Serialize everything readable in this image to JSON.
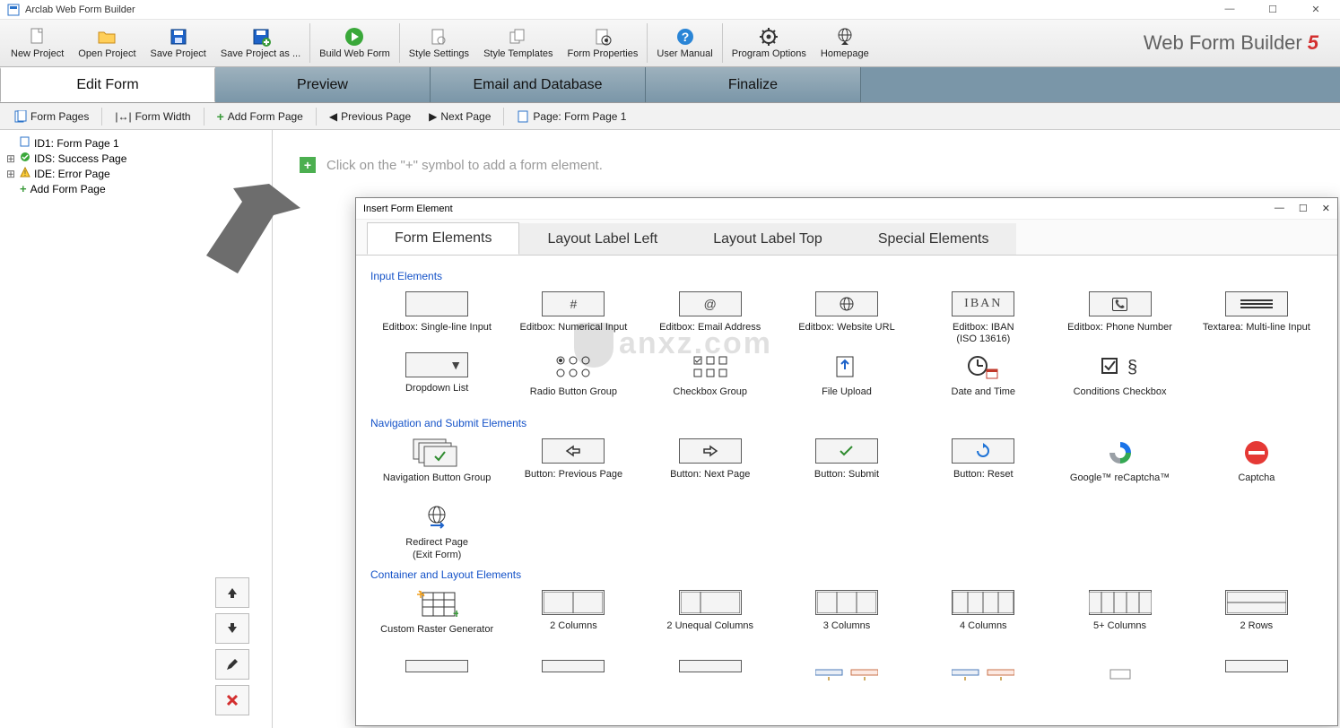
{
  "window": {
    "title": "Arclab Web Form Builder",
    "min": "—",
    "max": "☐",
    "close": "✕"
  },
  "ribbon": {
    "items": [
      {
        "label": "New Project",
        "icon": "file-new"
      },
      {
        "label": "Open Project",
        "icon": "folder-open"
      },
      {
        "label": "Save Project",
        "icon": "save"
      },
      {
        "label": "Save Project as ...",
        "icon": "save-plus"
      },
      {
        "label": "Build Web Form",
        "icon": "play"
      },
      {
        "label": "Style Settings",
        "icon": "style"
      },
      {
        "label": "Style Templates",
        "icon": "templates"
      },
      {
        "label": "Form Properties",
        "icon": "gear-doc"
      },
      {
        "label": "User Manual",
        "icon": "help"
      },
      {
        "label": "Program Options",
        "icon": "gear"
      },
      {
        "label": "Homepage",
        "icon": "globe-home"
      }
    ],
    "brand": "Web Form Builder",
    "brand_ver": "5"
  },
  "tabs": [
    "Edit Form",
    "Preview",
    "Email and Database",
    "Finalize"
  ],
  "active_tab": 0,
  "subbar": {
    "form_pages": "Form Pages",
    "form_width": "Form Width",
    "add_form_page": "Add Form Page",
    "prev_page": "Previous Page",
    "next_page": "Next Page",
    "page_label": "Page: Form Page 1"
  },
  "tree": [
    {
      "icon": "page",
      "label": "ID1: Form Page 1",
      "expandable": false
    },
    {
      "icon": "success",
      "label": "IDS: Success Page",
      "expandable": true
    },
    {
      "icon": "warning",
      "label": "IDE: Error Page",
      "expandable": true
    },
    {
      "icon": "plus",
      "label": "Add Form Page",
      "expandable": false
    }
  ],
  "canvas": {
    "hint": "Click on the \"+\" symbol to add a form element."
  },
  "dialog": {
    "title": "Insert Form Element",
    "tabs": [
      "Form Elements",
      "Layout Label Left",
      "Layout Label Top",
      "Special Elements"
    ],
    "active_tab": 0,
    "sections": [
      {
        "header": "Input Elements",
        "items": [
          {
            "label": "Editbox: Single-line Input",
            "glyph": ""
          },
          {
            "label": "Editbox: Numerical Input",
            "glyph": "#"
          },
          {
            "label": "Editbox: Email Address",
            "glyph": "@"
          },
          {
            "label": "Editbox: Website URL",
            "glyph": "globe"
          },
          {
            "label": "Editbox: IBAN (ISO 13616)",
            "glyph": "IBAN"
          },
          {
            "label": "Editbox: Phone Number",
            "glyph": "phone"
          },
          {
            "label": "Textarea: Multi-line Input",
            "glyph": "lines"
          },
          {
            "label": "Dropdown List",
            "glyph": "▼"
          },
          {
            "label": "Radio Button Group",
            "glyph": "radios",
            "noframe": true
          },
          {
            "label": "Checkbox Group",
            "glyph": "checks",
            "noframe": true
          },
          {
            "label": "File Upload",
            "glyph": "upload",
            "noframe": true
          },
          {
            "label": "Date and Time",
            "glyph": "clockcal",
            "noframe": true
          },
          {
            "label": "Conditions Checkbox",
            "glyph": "cond",
            "noframe": true
          }
        ]
      },
      {
        "header": "Navigation and Submit Elements",
        "items": [
          {
            "label": "Navigation Button Group",
            "glyph": "navgroup",
            "noframe": true
          },
          {
            "label": "Button: Previous Page",
            "glyph": "⇦"
          },
          {
            "label": "Button: Next Page",
            "glyph": "⇨"
          },
          {
            "label": "Button: Submit",
            "glyph": "✓",
            "color": "#2e8b2e"
          },
          {
            "label": "Button: Reset",
            "glyph": "↻",
            "color": "#1e73d6"
          },
          {
            "label": "Google™ reCaptcha™",
            "glyph": "recaptcha",
            "noframe": true
          },
          {
            "label": "Captcha",
            "glyph": "noentry",
            "noframe": true
          },
          {
            "label": "Redirect Page (Exit Form)",
            "glyph": "redirect",
            "noframe": true
          }
        ]
      },
      {
        "header": "Container and Layout Elements",
        "items": [
          {
            "label": "Custom Raster Generator",
            "glyph": "raster",
            "noframe": true
          },
          {
            "label": "2 Columns",
            "glyph": "col2"
          },
          {
            "label": "2 Unequal Columns",
            "glyph": "col2u"
          },
          {
            "label": "3 Columns",
            "glyph": "col3"
          },
          {
            "label": "4 Columns",
            "glyph": "col4"
          },
          {
            "label": "5+ Columns",
            "glyph": "col5"
          },
          {
            "label": "2 Rows",
            "glyph": "row2"
          }
        ]
      }
    ]
  },
  "side_actions": [
    "up",
    "down",
    "edit",
    "delete"
  ]
}
